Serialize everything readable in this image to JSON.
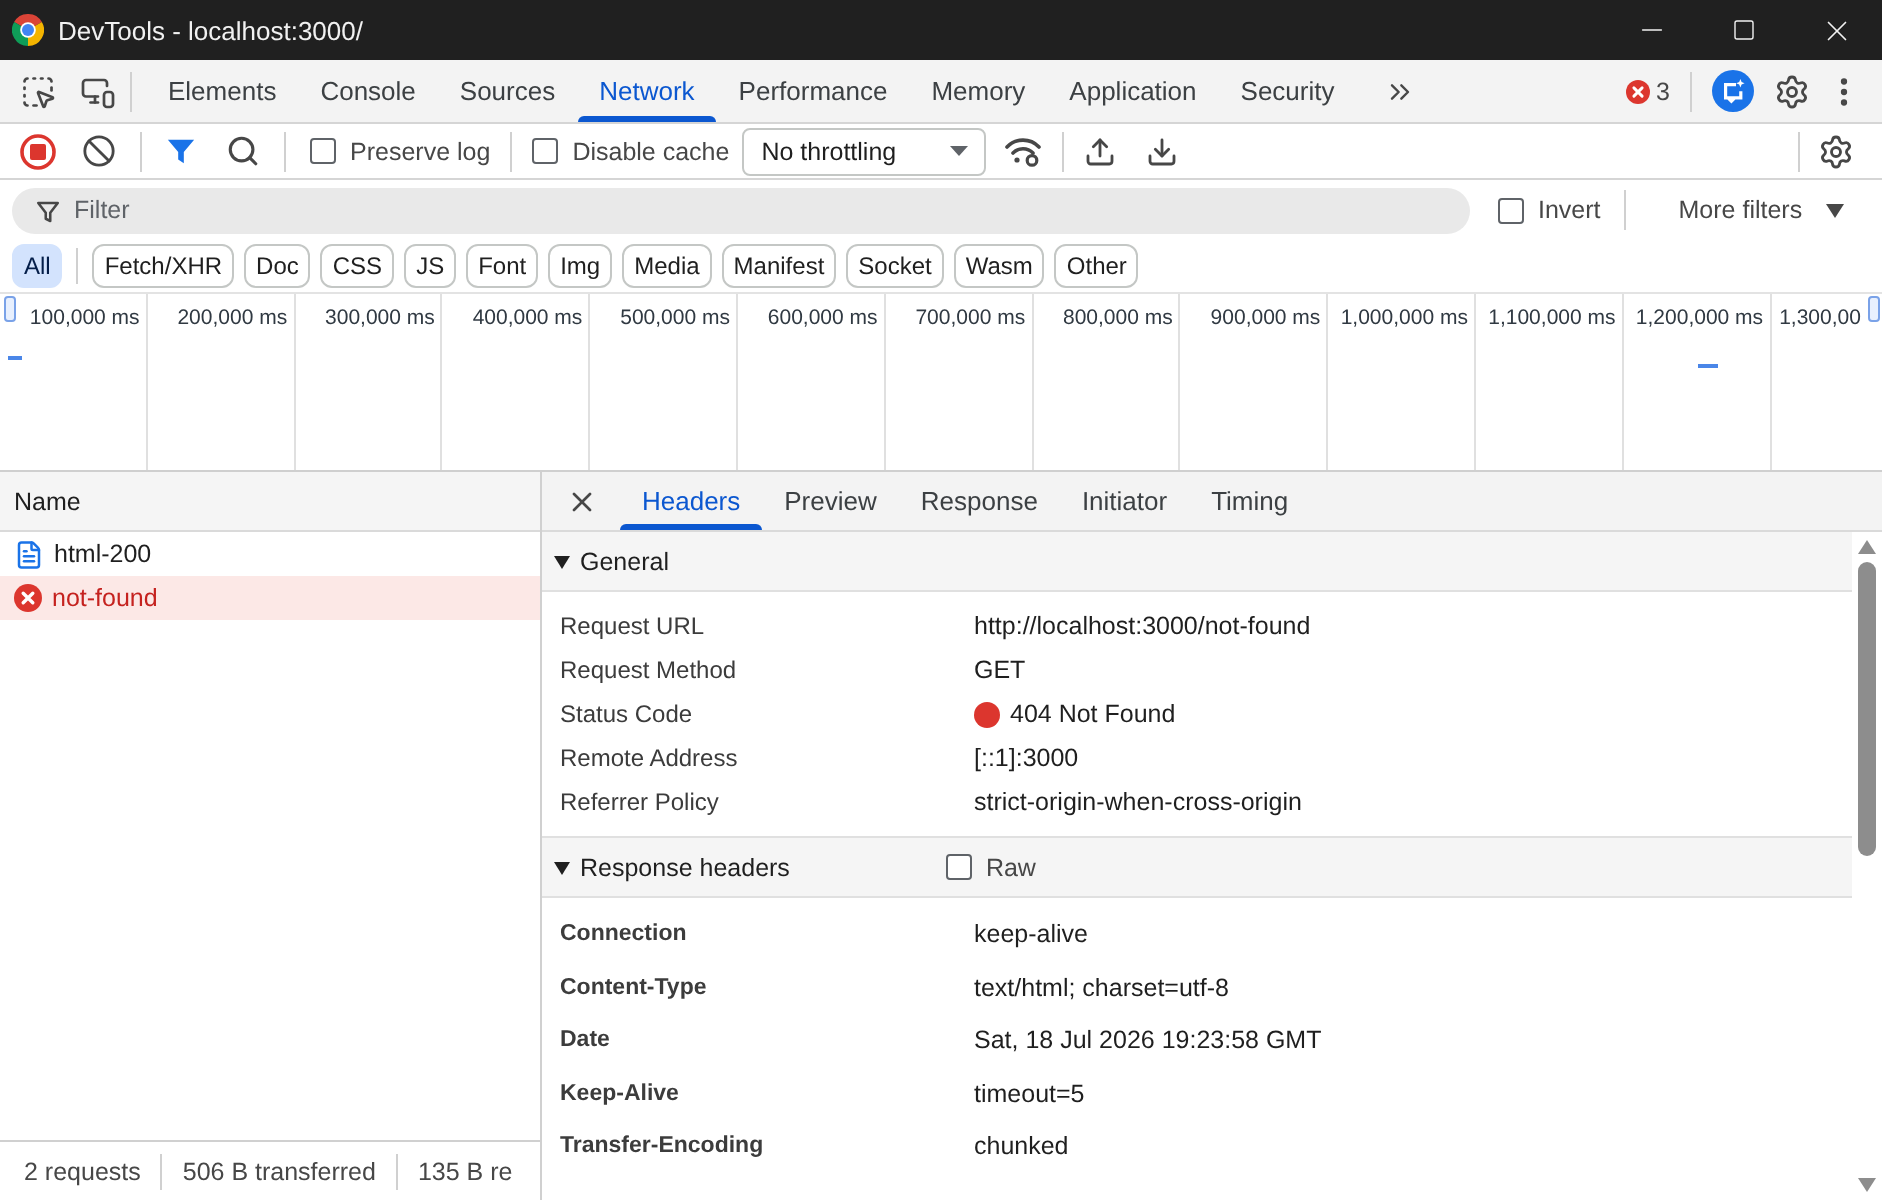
{
  "window": {
    "title": "DevTools - localhost:3000/"
  },
  "panel_tabs": [
    {
      "label": "Elements",
      "selected": false
    },
    {
      "label": "Console",
      "selected": false
    },
    {
      "label": "Sources",
      "selected": false
    },
    {
      "label": "Network",
      "selected": true
    },
    {
      "label": "Performance",
      "selected": false
    },
    {
      "label": "Memory",
      "selected": false
    },
    {
      "label": "Application",
      "selected": false
    },
    {
      "label": "Security",
      "selected": false
    }
  ],
  "error_count": "3",
  "toolbar": {
    "recording": true,
    "filter_active": true,
    "preserve_log": {
      "label": "Preserve log",
      "checked": false
    },
    "disable_cache": {
      "label": "Disable cache",
      "checked": false
    },
    "throttling": "No throttling"
  },
  "filter_bar": {
    "placeholder": "Filter",
    "invert": {
      "label": "Invert",
      "checked": false
    },
    "more_filters": "More filters"
  },
  "type_filters": [
    {
      "label": "All",
      "selected": true
    },
    {
      "label": "Fetch/XHR",
      "selected": false
    },
    {
      "label": "Doc",
      "selected": false
    },
    {
      "label": "CSS",
      "selected": false
    },
    {
      "label": "JS",
      "selected": false
    },
    {
      "label": "Font",
      "selected": false
    },
    {
      "label": "Img",
      "selected": false
    },
    {
      "label": "Media",
      "selected": false
    },
    {
      "label": "Manifest",
      "selected": false
    },
    {
      "label": "Socket",
      "selected": false
    },
    {
      "label": "Wasm",
      "selected": false
    },
    {
      "label": "Other",
      "selected": false
    }
  ],
  "overview": {
    "ticks": [
      "100,000 ms",
      "200,000 ms",
      "300,000 ms",
      "400,000 ms",
      "500,000 ms",
      "600,000 ms",
      "700,000 ms",
      "800,000 ms",
      "900,000 ms",
      "1,000,000 ms",
      "1,100,000 ms",
      "1,200,000 ms",
      "1,300,00"
    ]
  },
  "requests": {
    "column": "Name",
    "rows": [
      {
        "kind": "document",
        "name": "html-200",
        "selected": false
      },
      {
        "kind": "error",
        "name": "not-found",
        "selected": true
      }
    ]
  },
  "summary": [
    "2 requests",
    "506 B transferred",
    "135 B re"
  ],
  "details": {
    "tabs": [
      {
        "label": "Headers",
        "selected": true
      },
      {
        "label": "Preview",
        "selected": false
      },
      {
        "label": "Response",
        "selected": false
      },
      {
        "label": "Initiator",
        "selected": false
      },
      {
        "label": "Timing",
        "selected": false
      }
    ],
    "sections": [
      {
        "kind": "general",
        "title": "General",
        "expanded": true,
        "rows": [
          {
            "name": "Request URL",
            "value": "http://localhost:3000/not-found"
          },
          {
            "name": "Request Method",
            "value": "GET"
          },
          {
            "name": "Status Code",
            "value": "404 Not Found",
            "color": "#dc362e"
          },
          {
            "name": "Remote Address",
            "value": "[::1]:3000"
          },
          {
            "name": "Referrer Policy",
            "value": "strict-origin-when-cross-origin"
          }
        ]
      },
      {
        "kind": "response",
        "title": "Response headers",
        "expanded": true,
        "raw": {
          "label": "Raw",
          "checked": false
        },
        "rows": [
          {
            "name": "Connection",
            "value": "keep-alive"
          },
          {
            "name": "Content-Type",
            "value": "text/html; charset=utf-8"
          },
          {
            "name": "Date",
            "value": "Sat, 18 Jul 2026 19:23:58 GMT"
          },
          {
            "name": "Keep-Alive",
            "value": "timeout=5"
          },
          {
            "name": "Transfer-Encoding",
            "value": "chunked"
          }
        ]
      }
    ]
  }
}
